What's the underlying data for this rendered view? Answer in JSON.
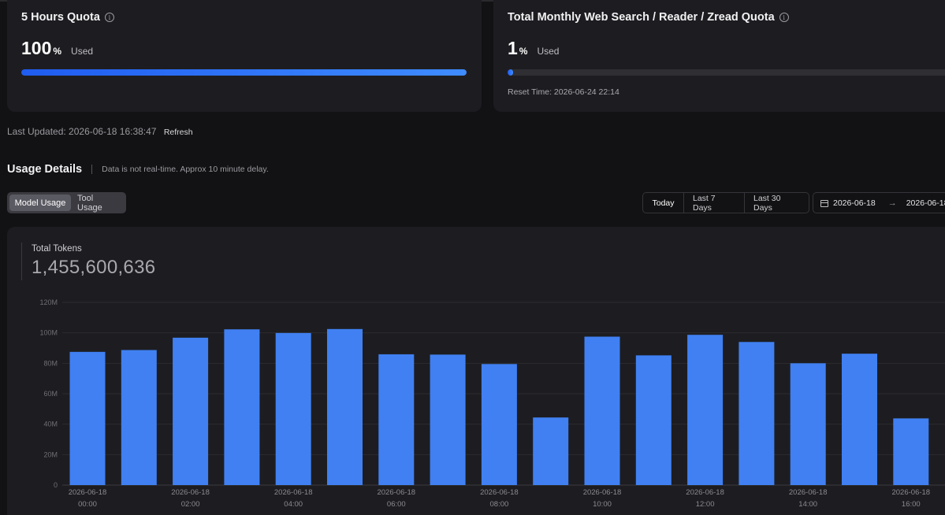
{
  "quota_cards": [
    {
      "title": "5 Hours Quota",
      "value": "100",
      "unit": "%",
      "used_label": "Used",
      "fill_fraction": 1.0
    },
    {
      "title": "Total Monthly Web Search / Reader / Zread Quota",
      "value": "1",
      "unit": "%",
      "used_label": "Used",
      "fill_fraction": 0.01,
      "reset_text": "Reset Time: 2026-06-24 22:14"
    }
  ],
  "last_updated": {
    "text": "Last Updated: 2026-06-18 16:38:47",
    "refresh_label": "Refresh"
  },
  "usage": {
    "title": "Usage Details",
    "note": "Data is not real-time. Approx 10 minute delay.",
    "tabs": [
      "Model Usage",
      "Tool Usage"
    ],
    "active_tab": "Model Usage",
    "ranges": [
      "Today",
      "Last 7 Days",
      "Last 30 Days"
    ],
    "active_range": "Today",
    "date_start": "2026-06-18",
    "date_end": "2026-06-18"
  },
  "total_tokens": {
    "label": "Total Tokens",
    "value": "1,455,600,636"
  },
  "colors": {
    "bar": "#4080f2",
    "accent": "#2a6ef5"
  },
  "chart_data": {
    "type": "bar",
    "categories": [
      "2026-06-18 00:00",
      "2026-06-18 01:00",
      "2026-06-18 02:00",
      "2026-06-18 03:00",
      "2026-06-18 04:00",
      "2026-06-18 05:00",
      "2026-06-18 06:00",
      "2026-06-18 07:00",
      "2026-06-18 08:00",
      "2026-06-18 09:00",
      "2026-06-18 10:00",
      "2026-06-18 11:00",
      "2026-06-18 12:00",
      "2026-06-18 13:00",
      "2026-06-18 14:00",
      "2026-06-18 15:00",
      "2026-06-18 16:00"
    ],
    "x_tick_labels": [
      {
        "date": "2026-06-18",
        "time": "00:00",
        "index": 0
      },
      {
        "date": "2026-06-18",
        "time": "02:00",
        "index": 2
      },
      {
        "date": "2026-06-18",
        "time": "04:00",
        "index": 4
      },
      {
        "date": "2026-06-18",
        "time": "06:00",
        "index": 6
      },
      {
        "date": "2026-06-18",
        "time": "08:00",
        "index": 8
      },
      {
        "date": "2026-06-18",
        "time": "10:00",
        "index": 10
      },
      {
        "date": "2026-06-18",
        "time": "12:00",
        "index": 12
      },
      {
        "date": "2026-06-18",
        "time": "14:00",
        "index": 14
      },
      {
        "date": "2026-06-18",
        "time": "16:00",
        "index": 16
      }
    ],
    "values": [
      87.5,
      88.7,
      96.8,
      102.3,
      99.9,
      102.5,
      85.9,
      85.7,
      79.5,
      44.4,
      97.5,
      85.2,
      98.7,
      94.0,
      80.0,
      86.3,
      43.8
    ],
    "value_unit": "M tokens",
    "y_ticks": [
      "0",
      "20M",
      "40M",
      "60M",
      "80M",
      "100M",
      "120M"
    ],
    "ylim": [
      0,
      120
    ],
    "grid": true
  }
}
